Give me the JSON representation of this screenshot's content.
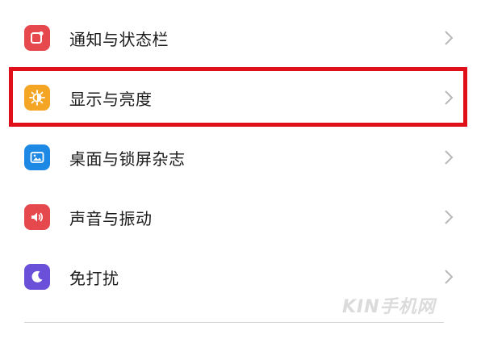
{
  "settings": {
    "items": [
      {
        "label": "通知与状态栏",
        "icon": "notification-icon",
        "icon_color": "#e5484d"
      },
      {
        "label": "显示与亮度",
        "icon": "brightness-icon",
        "icon_color": "#f5a524"
      },
      {
        "label": "桌面与锁屏杂志",
        "icon": "wallpaper-icon",
        "icon_color": "#1e88e5"
      },
      {
        "label": "声音与振动",
        "icon": "volume-icon",
        "icon_color": "#e5484d"
      },
      {
        "label": "免打扰",
        "icon": "moon-icon",
        "icon_color": "#6a4fd8"
      }
    ]
  },
  "highlight": {
    "color": "#e0101a"
  },
  "watermark": {
    "text": "KIN手机网"
  }
}
